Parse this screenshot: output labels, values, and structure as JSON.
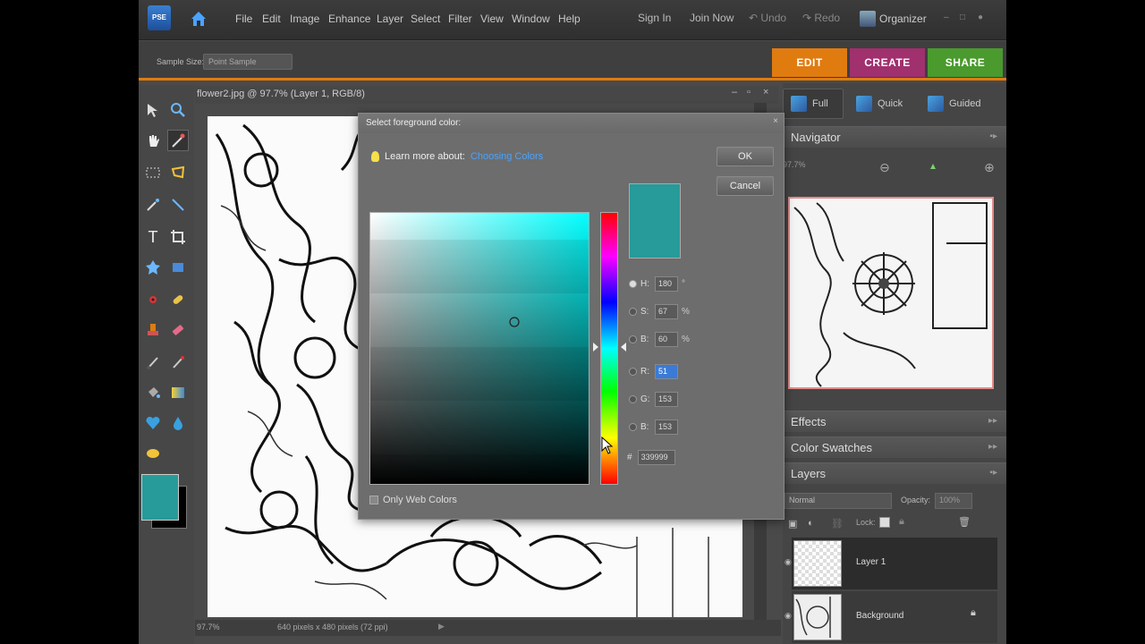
{
  "app": {
    "logo_text": "PSE",
    "menu": [
      "File",
      "Edit",
      "Image",
      "Enhance",
      "Layer",
      "Select",
      "Filter",
      "View",
      "Window",
      "Help"
    ],
    "sign_in": "Sign In",
    "join_now": "Join Now",
    "undo": "Undo",
    "redo": "Redo",
    "organizer": "Organizer",
    "mode_tabs": [
      {
        "label": "EDIT",
        "color": "#e07b10"
      },
      {
        "label": "CREATE",
        "color": "#a0306e"
      },
      {
        "label": "SHARE",
        "color": "#4a9a2e"
      }
    ],
    "sub_tabs": [
      "Full",
      "Quick",
      "Guided"
    ]
  },
  "options_bar": {
    "label": "Sample Size:",
    "value": "Point Sample"
  },
  "document": {
    "title": "flower2.jpg @ 97.7% (Layer 1, RGB/8)",
    "zoom": "97.7%",
    "status": "640 pixels x 480 pixels (72 ppi)"
  },
  "panels": {
    "navigator": "Navigator",
    "nav_zoom": "97.7%",
    "effects": "Effects",
    "color_swatches": "Color Swatches",
    "layers": "Layers",
    "blend_mode": "Normal",
    "opacity_label": "Opacity:",
    "opacity_value": "100%",
    "lock_label": "Lock:",
    "layer_items": [
      {
        "name": "Layer 1"
      },
      {
        "name": "Background"
      }
    ]
  },
  "dialog": {
    "title": "Select foreground color:",
    "learn_label": "Learn more about:",
    "learn_link": "Choosing Colors",
    "ok": "OK",
    "cancel": "Cancel",
    "fields": {
      "H": {
        "value": "180",
        "unit": "°"
      },
      "S": {
        "value": "67",
        "unit": "%"
      },
      "B": {
        "value": "60",
        "unit": "%"
      },
      "R": {
        "value": "51",
        "unit": ""
      },
      "G": {
        "value": "153",
        "unit": ""
      },
      "Bl": {
        "value": "153",
        "unit": ""
      }
    },
    "hex_label": "#",
    "hex": "339999",
    "web_only": "Only Web Colors",
    "current_color": "#279a9a"
  }
}
